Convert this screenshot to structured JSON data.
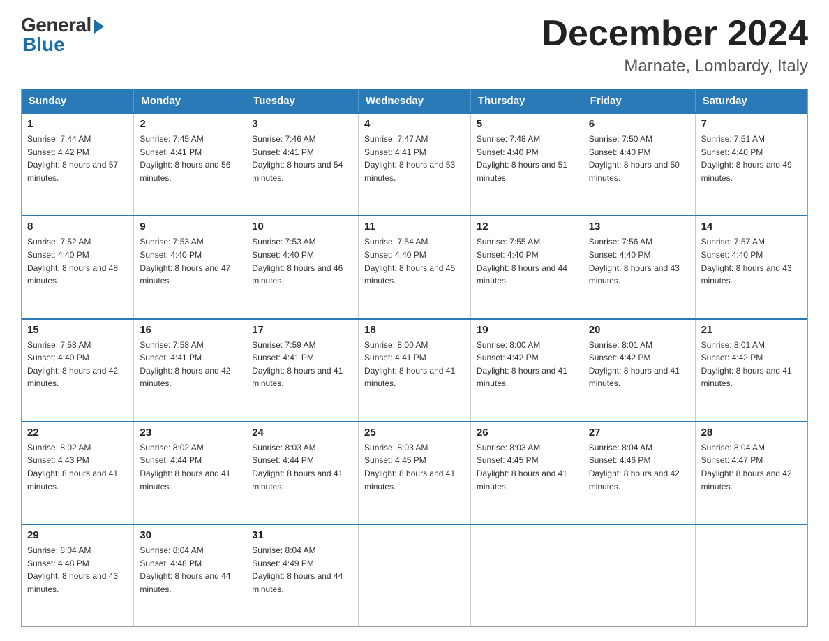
{
  "logo": {
    "general": "General",
    "blue": "Blue"
  },
  "header": {
    "month_year": "December 2024",
    "location": "Marnate, Lombardy, Italy"
  },
  "days_of_week": [
    "Sunday",
    "Monday",
    "Tuesday",
    "Wednesday",
    "Thursday",
    "Friday",
    "Saturday"
  ],
  "weeks": [
    [
      {
        "day": "1",
        "sunrise": "7:44 AM",
        "sunset": "4:42 PM",
        "daylight": "8 hours and 57 minutes."
      },
      {
        "day": "2",
        "sunrise": "7:45 AM",
        "sunset": "4:41 PM",
        "daylight": "8 hours and 56 minutes."
      },
      {
        "day": "3",
        "sunrise": "7:46 AM",
        "sunset": "4:41 PM",
        "daylight": "8 hours and 54 minutes."
      },
      {
        "day": "4",
        "sunrise": "7:47 AM",
        "sunset": "4:41 PM",
        "daylight": "8 hours and 53 minutes."
      },
      {
        "day": "5",
        "sunrise": "7:48 AM",
        "sunset": "4:40 PM",
        "daylight": "8 hours and 51 minutes."
      },
      {
        "day": "6",
        "sunrise": "7:50 AM",
        "sunset": "4:40 PM",
        "daylight": "8 hours and 50 minutes."
      },
      {
        "day": "7",
        "sunrise": "7:51 AM",
        "sunset": "4:40 PM",
        "daylight": "8 hours and 49 minutes."
      }
    ],
    [
      {
        "day": "8",
        "sunrise": "7:52 AM",
        "sunset": "4:40 PM",
        "daylight": "8 hours and 48 minutes."
      },
      {
        "day": "9",
        "sunrise": "7:53 AM",
        "sunset": "4:40 PM",
        "daylight": "8 hours and 47 minutes."
      },
      {
        "day": "10",
        "sunrise": "7:53 AM",
        "sunset": "4:40 PM",
        "daylight": "8 hours and 46 minutes."
      },
      {
        "day": "11",
        "sunrise": "7:54 AM",
        "sunset": "4:40 PM",
        "daylight": "8 hours and 45 minutes."
      },
      {
        "day": "12",
        "sunrise": "7:55 AM",
        "sunset": "4:40 PM",
        "daylight": "8 hours and 44 minutes."
      },
      {
        "day": "13",
        "sunrise": "7:56 AM",
        "sunset": "4:40 PM",
        "daylight": "8 hours and 43 minutes."
      },
      {
        "day": "14",
        "sunrise": "7:57 AM",
        "sunset": "4:40 PM",
        "daylight": "8 hours and 43 minutes."
      }
    ],
    [
      {
        "day": "15",
        "sunrise": "7:58 AM",
        "sunset": "4:40 PM",
        "daylight": "8 hours and 42 minutes."
      },
      {
        "day": "16",
        "sunrise": "7:58 AM",
        "sunset": "4:41 PM",
        "daylight": "8 hours and 42 minutes."
      },
      {
        "day": "17",
        "sunrise": "7:59 AM",
        "sunset": "4:41 PM",
        "daylight": "8 hours and 41 minutes."
      },
      {
        "day": "18",
        "sunrise": "8:00 AM",
        "sunset": "4:41 PM",
        "daylight": "8 hours and 41 minutes."
      },
      {
        "day": "19",
        "sunrise": "8:00 AM",
        "sunset": "4:42 PM",
        "daylight": "8 hours and 41 minutes."
      },
      {
        "day": "20",
        "sunrise": "8:01 AM",
        "sunset": "4:42 PM",
        "daylight": "8 hours and 41 minutes."
      },
      {
        "day": "21",
        "sunrise": "8:01 AM",
        "sunset": "4:42 PM",
        "daylight": "8 hours and 41 minutes."
      }
    ],
    [
      {
        "day": "22",
        "sunrise": "8:02 AM",
        "sunset": "4:43 PM",
        "daylight": "8 hours and 41 minutes."
      },
      {
        "day": "23",
        "sunrise": "8:02 AM",
        "sunset": "4:44 PM",
        "daylight": "8 hours and 41 minutes."
      },
      {
        "day": "24",
        "sunrise": "8:03 AM",
        "sunset": "4:44 PM",
        "daylight": "8 hours and 41 minutes."
      },
      {
        "day": "25",
        "sunrise": "8:03 AM",
        "sunset": "4:45 PM",
        "daylight": "8 hours and 41 minutes."
      },
      {
        "day": "26",
        "sunrise": "8:03 AM",
        "sunset": "4:45 PM",
        "daylight": "8 hours and 41 minutes."
      },
      {
        "day": "27",
        "sunrise": "8:04 AM",
        "sunset": "4:46 PM",
        "daylight": "8 hours and 42 minutes."
      },
      {
        "day": "28",
        "sunrise": "8:04 AM",
        "sunset": "4:47 PM",
        "daylight": "8 hours and 42 minutes."
      }
    ],
    [
      {
        "day": "29",
        "sunrise": "8:04 AM",
        "sunset": "4:48 PM",
        "daylight": "8 hours and 43 minutes."
      },
      {
        "day": "30",
        "sunrise": "8:04 AM",
        "sunset": "4:48 PM",
        "daylight": "8 hours and 44 minutes."
      },
      {
        "day": "31",
        "sunrise": "8:04 AM",
        "sunset": "4:49 PM",
        "daylight": "8 hours and 44 minutes."
      },
      null,
      null,
      null,
      null
    ]
  ]
}
